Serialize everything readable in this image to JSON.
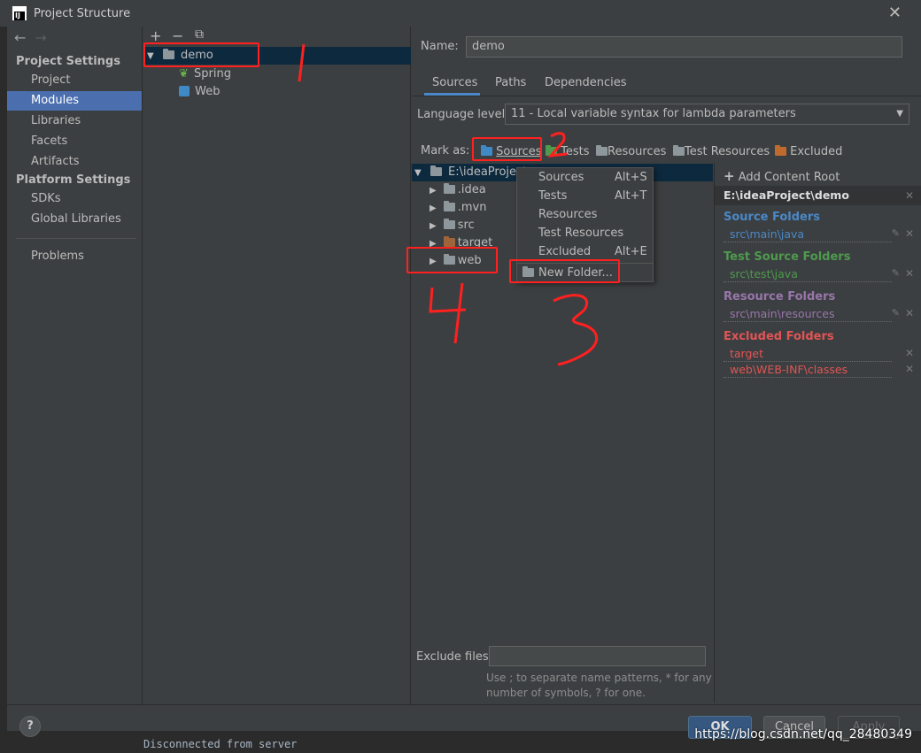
{
  "window": {
    "title": "Project Structure",
    "close": "✕"
  },
  "nav": {
    "back": "←",
    "forward": "→",
    "project_settings_header": "Project Settings",
    "items_ps": [
      "Project",
      "Modules",
      "Libraries",
      "Facets",
      "Artifacts"
    ],
    "platform_header": "Platform Settings",
    "items_pl": [
      "SDKs",
      "Global Libraries"
    ],
    "problems": "Problems"
  },
  "modules": {
    "toolbar": {
      "add": "+",
      "remove": "−",
      "copy": "⧉"
    },
    "tree": [
      {
        "label": "demo"
      },
      {
        "label": "Spring"
      },
      {
        "label": "Web"
      }
    ]
  },
  "content": {
    "name_label": "Name:",
    "name_value": "demo",
    "tabs": [
      "Sources",
      "Paths",
      "Dependencies"
    ],
    "language_level_label": "Language level:",
    "language_level_value": "11 - Local variable syntax for lambda parameters",
    "mark_as_label": "Mark as:",
    "mark_as": [
      "Sources",
      "Tests",
      "Resources",
      "Test Resources",
      "Excluded"
    ],
    "tree": {
      "root": "E:\\ideaProject",
      "children": [
        ".idea",
        ".mvn",
        "src",
        "target",
        "web"
      ]
    },
    "exclude_files_label": "Exclude files:",
    "exclude_hint_1": "Use ; to separate name patterns, * for any",
    "exclude_hint_2": "number of symbols, ? for one."
  },
  "context_menu": [
    {
      "label": "Sources",
      "shortcut": "Alt+S"
    },
    {
      "label": "Tests",
      "shortcut": "Alt+T"
    },
    {
      "label": "Resources",
      "shortcut": ""
    },
    {
      "label": "Test Resources",
      "shortcut": ""
    },
    {
      "label": "Excluded",
      "shortcut": "Alt+E"
    },
    {
      "label": "New Folder...",
      "shortcut": ""
    }
  ],
  "roots": {
    "add_content_root": "Add Content Root",
    "path": "E:\\ideaProject\\demo",
    "source_header": "Source Folders",
    "source_items": [
      "src\\main\\java"
    ],
    "test_header": "Test Source Folders",
    "test_items": [
      "src\\test\\java"
    ],
    "resource_header": "Resource Folders",
    "resource_items": [
      "src\\main\\resources"
    ],
    "excluded_header": "Excluded Folders",
    "excluded_items": [
      "target",
      "web\\WEB-INF\\classes"
    ],
    "colors": {
      "source": "#4a88c7",
      "test": "#4e9a4e",
      "resource": "#9876aa",
      "excluded": "#e05555"
    }
  },
  "footer": {
    "help": "?",
    "ok": "OK",
    "cancel": "Cancel",
    "apply": "Apply"
  },
  "background": {
    "console_text": "Disconnected from server"
  },
  "watermark": "https://blog.csdn.net/qq_28480349"
}
